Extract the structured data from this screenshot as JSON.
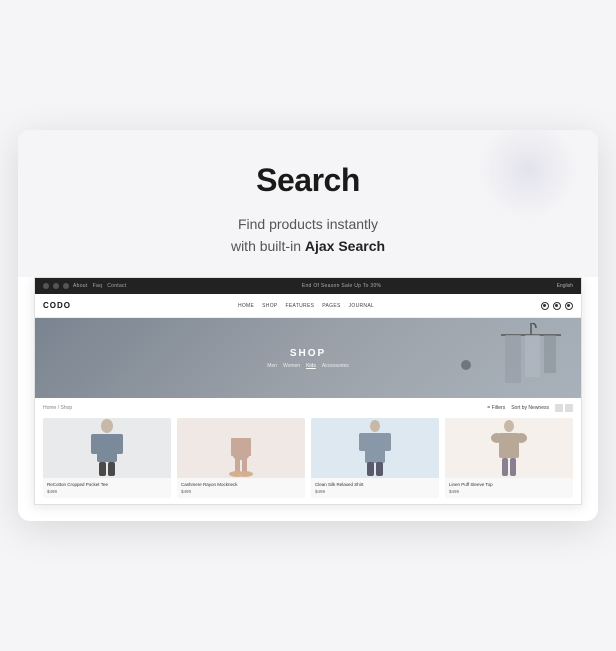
{
  "card": {
    "header": {
      "title": "Search",
      "subtitle_line1": "Find products instantly",
      "subtitle_line2": "with built-in ",
      "subtitle_bold": "Ajax Search"
    }
  },
  "browser": {
    "topbar": {
      "center_text": "End Of Season Sale Up To 30%",
      "right_text": "English"
    },
    "nav": {
      "logo": "CODO",
      "links": [
        "HOME",
        "SHOP",
        "FEATURES",
        "PAGES",
        "JOURNAL"
      ]
    },
    "hero": {
      "title": "SHOP",
      "nav_items": [
        "Men",
        "Women",
        "Kids",
        "Accessories"
      ]
    },
    "shop": {
      "breadcrumb": "Home / Shop",
      "filter_label": "= Filters",
      "sort_label": "Sort by Newness",
      "products": [
        {
          "name": "ReCotton Cropped Pocket Tee",
          "price": "$499",
          "bg": "bg-light",
          "figure": "woman-tee"
        },
        {
          "name": "Cashmere Rayon Mockneck",
          "price": "$499",
          "bg": "bg-pink",
          "figure": "shoes"
        },
        {
          "name": "Clean Silk Relaxed Shirt",
          "price": "$499",
          "bg": "bg-blue",
          "figure": "man-shirt"
        },
        {
          "name": "Linen Puff Sleeve Top",
          "price": "$499",
          "bg": "bg-offwhite",
          "figure": "woman-top"
        }
      ]
    }
  }
}
